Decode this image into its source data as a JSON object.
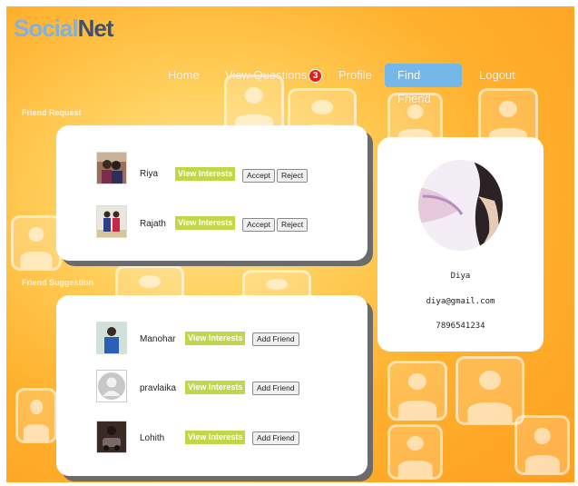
{
  "app": {
    "logo_part1": "Social",
    "logo_part2": "Net"
  },
  "nav": {
    "home": "Home",
    "view_questions": "View Questions",
    "questions_badge": "3",
    "profile": "Profile",
    "find_friend": "Find Friend",
    "logout": "Logout"
  },
  "friend_requests": {
    "label": "Friend Request",
    "items": [
      {
        "name": "Riya",
        "view_label": "View Interests",
        "accept_label": "Accept",
        "reject_label": "Reject"
      },
      {
        "name": "Rajath",
        "view_label": "View Interests",
        "accept_label": "Accept",
        "reject_label": "Reject"
      }
    ]
  },
  "friend_suggestions": {
    "label": "Friend Suggestion",
    "items": [
      {
        "name": "Manohar",
        "view_label": "View Interests",
        "add_label": "Add Friend"
      },
      {
        "name": "pravlaika",
        "view_label": "View Interests",
        "add_label": "Add Friend"
      },
      {
        "name": "Lohith",
        "view_label": "View Interests",
        "add_label": "Add Friend"
      }
    ]
  },
  "profile": {
    "name": "Diya",
    "email": "diya@gmail.com",
    "phone": "7896541234"
  },
  "colors": {
    "accent": "#74b8ea",
    "view_interests": "#c2d64a",
    "badge": "#e01e1e",
    "background": "#ffb12e"
  }
}
